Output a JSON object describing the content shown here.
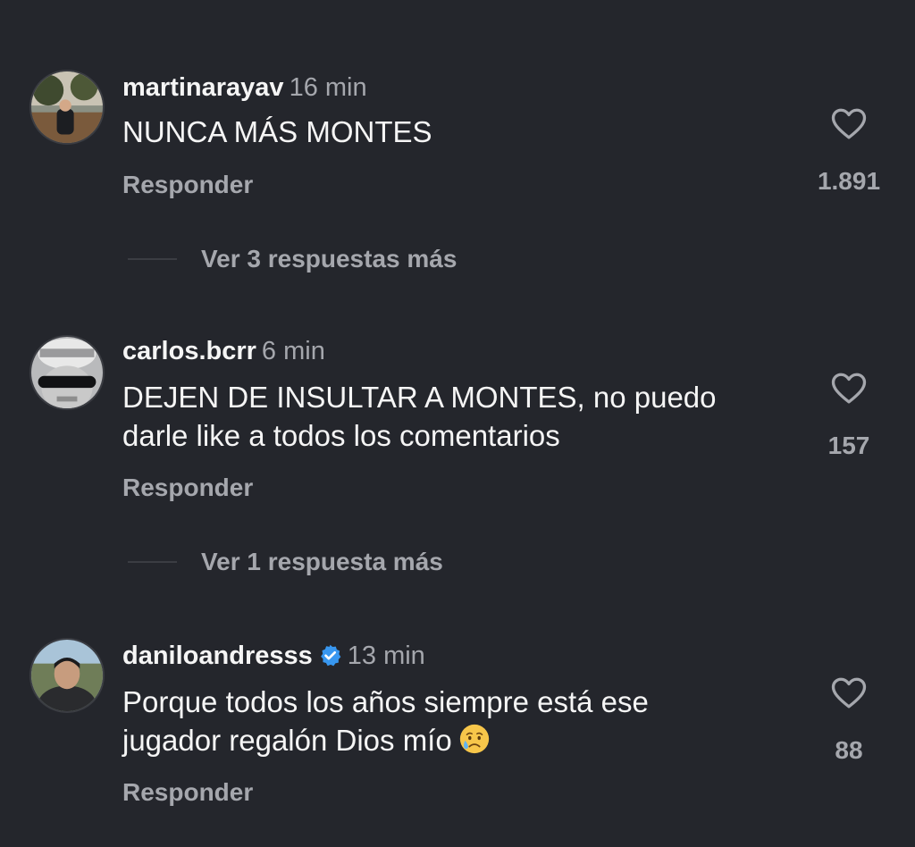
{
  "comments": [
    {
      "username": "martinarayav",
      "time": "16 min",
      "verified": false,
      "lines": [
        "NUNCA MÁS MONTES"
      ],
      "reply_label": "Responder",
      "likes": "1.891",
      "view_replies": "Ver 3 respuestas más"
    },
    {
      "username": "carlos.bcrr",
      "time": "6 min",
      "verified": false,
      "lines": [
        "DEJEN DE INSULTAR A MONTES, no puedo",
        "darle like a todos los comentarios"
      ],
      "reply_label": "Responder",
      "likes": "157",
      "view_replies": "Ver 1 respuesta más"
    },
    {
      "username": "daniloandresss",
      "time": "13 min",
      "verified": true,
      "lines": [
        "Porque todos los años siempre está ese",
        "jugador regalón Dios mío"
      ],
      "emoji": "crying-face",
      "reply_label": "Responder",
      "likes": "88"
    }
  ],
  "colors": {
    "background": "#24262c",
    "text": "#f5f5f5",
    "secondary_text": "#a5a7ad",
    "verified_badge": "#3897f0"
  }
}
